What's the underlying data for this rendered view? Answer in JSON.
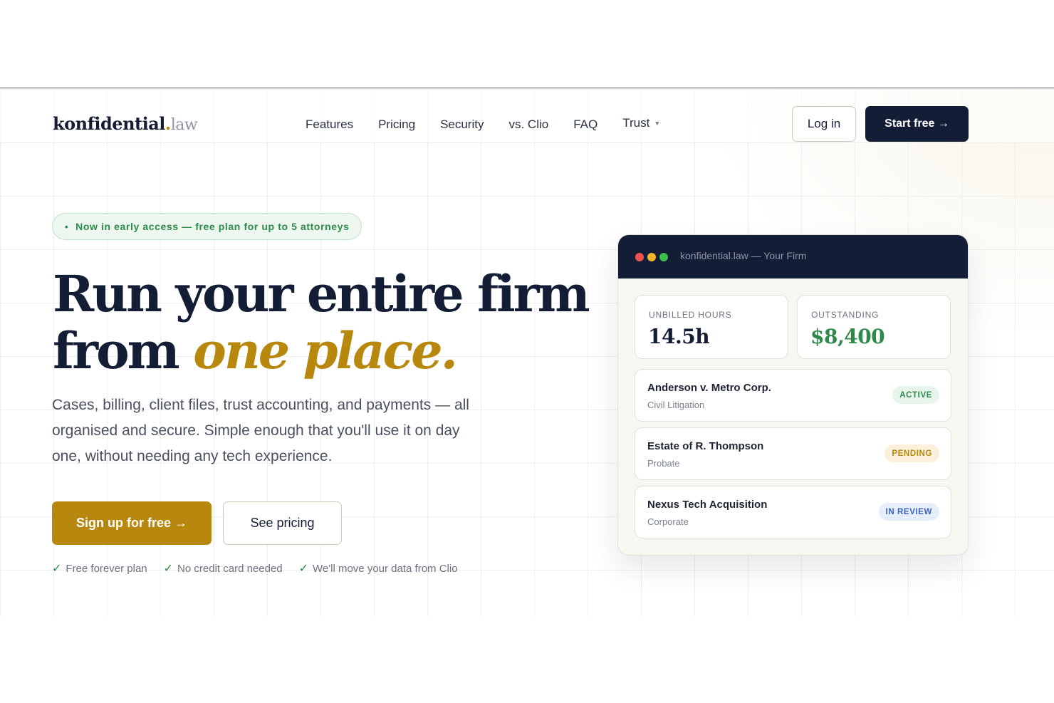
{
  "nav": {
    "logo_main": "konfidential",
    "logo_dot": ".",
    "logo_tld": "law",
    "links": [
      {
        "label": "Features"
      },
      {
        "label": "Pricing"
      },
      {
        "label": "Security"
      },
      {
        "label": "vs. Clio"
      },
      {
        "label": "FAQ"
      },
      {
        "label": "Trust"
      }
    ],
    "login_label": "Log in",
    "start_label": "Start free →"
  },
  "hero": {
    "pill_bullet": "•",
    "pill_text": "Now in early access — free plan for up to 5 attorneys",
    "headline_line1": "Run your entire firm",
    "headline_line2_plain": "from ",
    "headline_line2_accent": "one place.",
    "subtext": "Cases, billing, client files, trust accounting, and payments — all organised and secure. Simple enough that you'll use it on day one, without needing any tech experience.",
    "signup_label": "Sign up for free →",
    "pricing_label": "See pricing",
    "checks": [
      {
        "tick": "✓",
        "text": "Free forever plan"
      },
      {
        "tick": "✓",
        "text": "No credit card needed"
      },
      {
        "tick": "✓",
        "text": "We'll move your data from Clio"
      }
    ]
  },
  "preview": {
    "window_title": "konfidential.law — Your Firm",
    "stats": [
      {
        "label": "UNBILLED HOURS",
        "value": "14.5h"
      },
      {
        "label": "OUTSTANDING",
        "value": "$8,400"
      }
    ],
    "cases": [
      {
        "name": "Anderson v. Metro Corp.",
        "type": "Civil Litigation",
        "status": "ACTIVE"
      },
      {
        "name": "Estate of R. Thompson",
        "type": "Probate",
        "status": "PENDING"
      },
      {
        "name": "Nexus Tech Acquisition",
        "type": "Corporate",
        "status": "IN REVIEW"
      }
    ]
  },
  "colors": {
    "navy": "#131d36",
    "gold": "#b8870d",
    "green": "#2c8a4a",
    "blue": "#3a62b8"
  }
}
